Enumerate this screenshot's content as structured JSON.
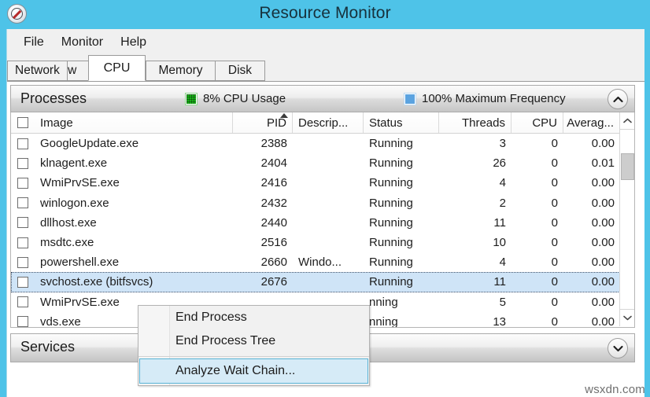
{
  "window": {
    "title": "Resource Monitor",
    "icon": "resource-monitor-icon"
  },
  "menubar": {
    "items": [
      {
        "label": "File"
      },
      {
        "label": "Monitor"
      },
      {
        "label": "Help"
      }
    ]
  },
  "tabs": [
    {
      "label": "Overview",
      "active": false
    },
    {
      "label": "CPU",
      "active": true
    },
    {
      "label": "Memory",
      "active": false
    },
    {
      "label": "Disk",
      "active": false
    },
    {
      "label": "Network",
      "active": false
    }
  ],
  "processes_section": {
    "title": "Processes",
    "cpu_usage": "8% CPU Usage",
    "max_frequency": "100% Maximum Frequency",
    "cpu_swatch_color": "#18b018",
    "frequency_swatch_color": "#5ba3e0",
    "collapse_icon": "chevron-up-icon"
  },
  "table": {
    "columns": [
      {
        "key": "image",
        "label": "Image",
        "align": "left",
        "sorted": false
      },
      {
        "key": "pid",
        "label": "PID",
        "align": "right",
        "sorted": true,
        "sort_dir": "asc"
      },
      {
        "key": "desc",
        "label": "Descrip...",
        "align": "left",
        "sorted": false
      },
      {
        "key": "status",
        "label": "Status",
        "align": "left",
        "sorted": false
      },
      {
        "key": "threads",
        "label": "Threads",
        "align": "right",
        "sorted": false
      },
      {
        "key": "cpu",
        "label": "CPU",
        "align": "right",
        "sorted": false
      },
      {
        "key": "average",
        "label": "Averag...",
        "align": "right",
        "sorted": false
      }
    ],
    "rows": [
      {
        "image": "GoogleUpdate.exe",
        "pid": "2388",
        "desc": "",
        "status": "Running",
        "threads": "3",
        "cpu": "0",
        "average": "0.00",
        "selected": false
      },
      {
        "image": "klnagent.exe",
        "pid": "2404",
        "desc": "",
        "status": "Running",
        "threads": "26",
        "cpu": "0",
        "average": "0.01",
        "selected": false
      },
      {
        "image": "WmiPrvSE.exe",
        "pid": "2416",
        "desc": "",
        "status": "Running",
        "threads": "4",
        "cpu": "0",
        "average": "0.00",
        "selected": false
      },
      {
        "image": "winlogon.exe",
        "pid": "2432",
        "desc": "",
        "status": "Running",
        "threads": "2",
        "cpu": "0",
        "average": "0.00",
        "selected": false
      },
      {
        "image": "dllhost.exe",
        "pid": "2440",
        "desc": "",
        "status": "Running",
        "threads": "11",
        "cpu": "0",
        "average": "0.00",
        "selected": false
      },
      {
        "image": "msdtc.exe",
        "pid": "2516",
        "desc": "",
        "status": "Running",
        "threads": "10",
        "cpu": "0",
        "average": "0.00",
        "selected": false
      },
      {
        "image": "powershell.exe",
        "pid": "2660",
        "desc": "Windo...",
        "status": "Running",
        "threads": "4",
        "cpu": "0",
        "average": "0.00",
        "selected": false
      },
      {
        "image": "svchost.exe (bitfsvcs)",
        "pid": "2676",
        "desc": "",
        "status": "Running",
        "threads": "11",
        "cpu": "0",
        "average": "0.00",
        "selected": true
      },
      {
        "image": "WmiPrvSE.exe",
        "pid": "",
        "desc": "",
        "status": "nning",
        "threads": "5",
        "cpu": "0",
        "average": "0.00",
        "selected": false
      },
      {
        "image": "vds.exe",
        "pid": "",
        "desc": "",
        "status": "nning",
        "threads": "13",
        "cpu": "0",
        "average": "0.00",
        "selected": false
      }
    ]
  },
  "scrollbar": {
    "up_icon": "chevron-up-icon",
    "down_icon": "chevron-down-icon"
  },
  "services_section": {
    "title": "Services",
    "expand_icon": "chevron-down-icon"
  },
  "context_menu": {
    "items": [
      {
        "label": "End Process",
        "highlighted": false,
        "separator_after": false
      },
      {
        "label": "End Process Tree",
        "highlighted": false,
        "separator_after": true
      },
      {
        "label": "Analyze Wait Chain...",
        "highlighted": true,
        "separator_after": false
      }
    ]
  },
  "watermark": {
    "text": "wsxdn.com"
  }
}
